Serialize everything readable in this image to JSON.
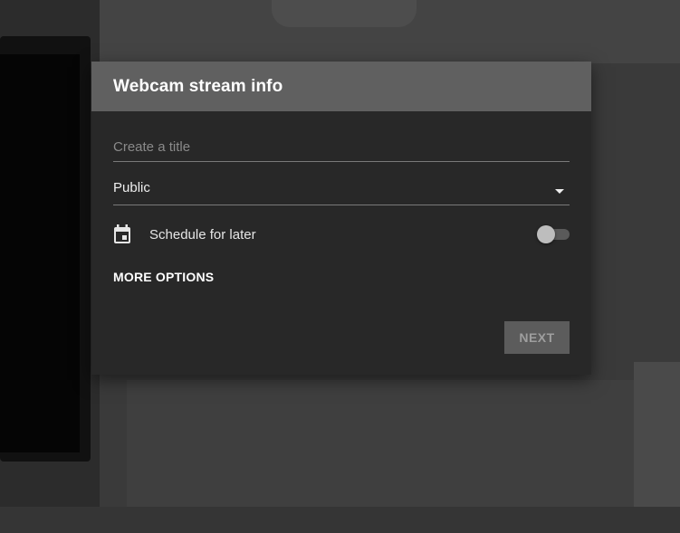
{
  "dialog": {
    "title": "Webcam stream info",
    "title_field": {
      "placeholder": "Create a title",
      "value": ""
    },
    "privacy": {
      "selected": "Public"
    },
    "schedule": {
      "label": "Schedule for later",
      "enabled": false
    },
    "more_options_label": "MORE OPTIONS",
    "next_label": "NEXT"
  },
  "colors": {
    "header_bg": "#606060",
    "dialog_bg": "#282828",
    "next_button_bg": "#5c5c5c",
    "next_button_text": "#9e9e9e"
  },
  "icons": {
    "schedule": "calendar-icon",
    "privacy_dropdown": "dropdown-arrow-icon"
  }
}
